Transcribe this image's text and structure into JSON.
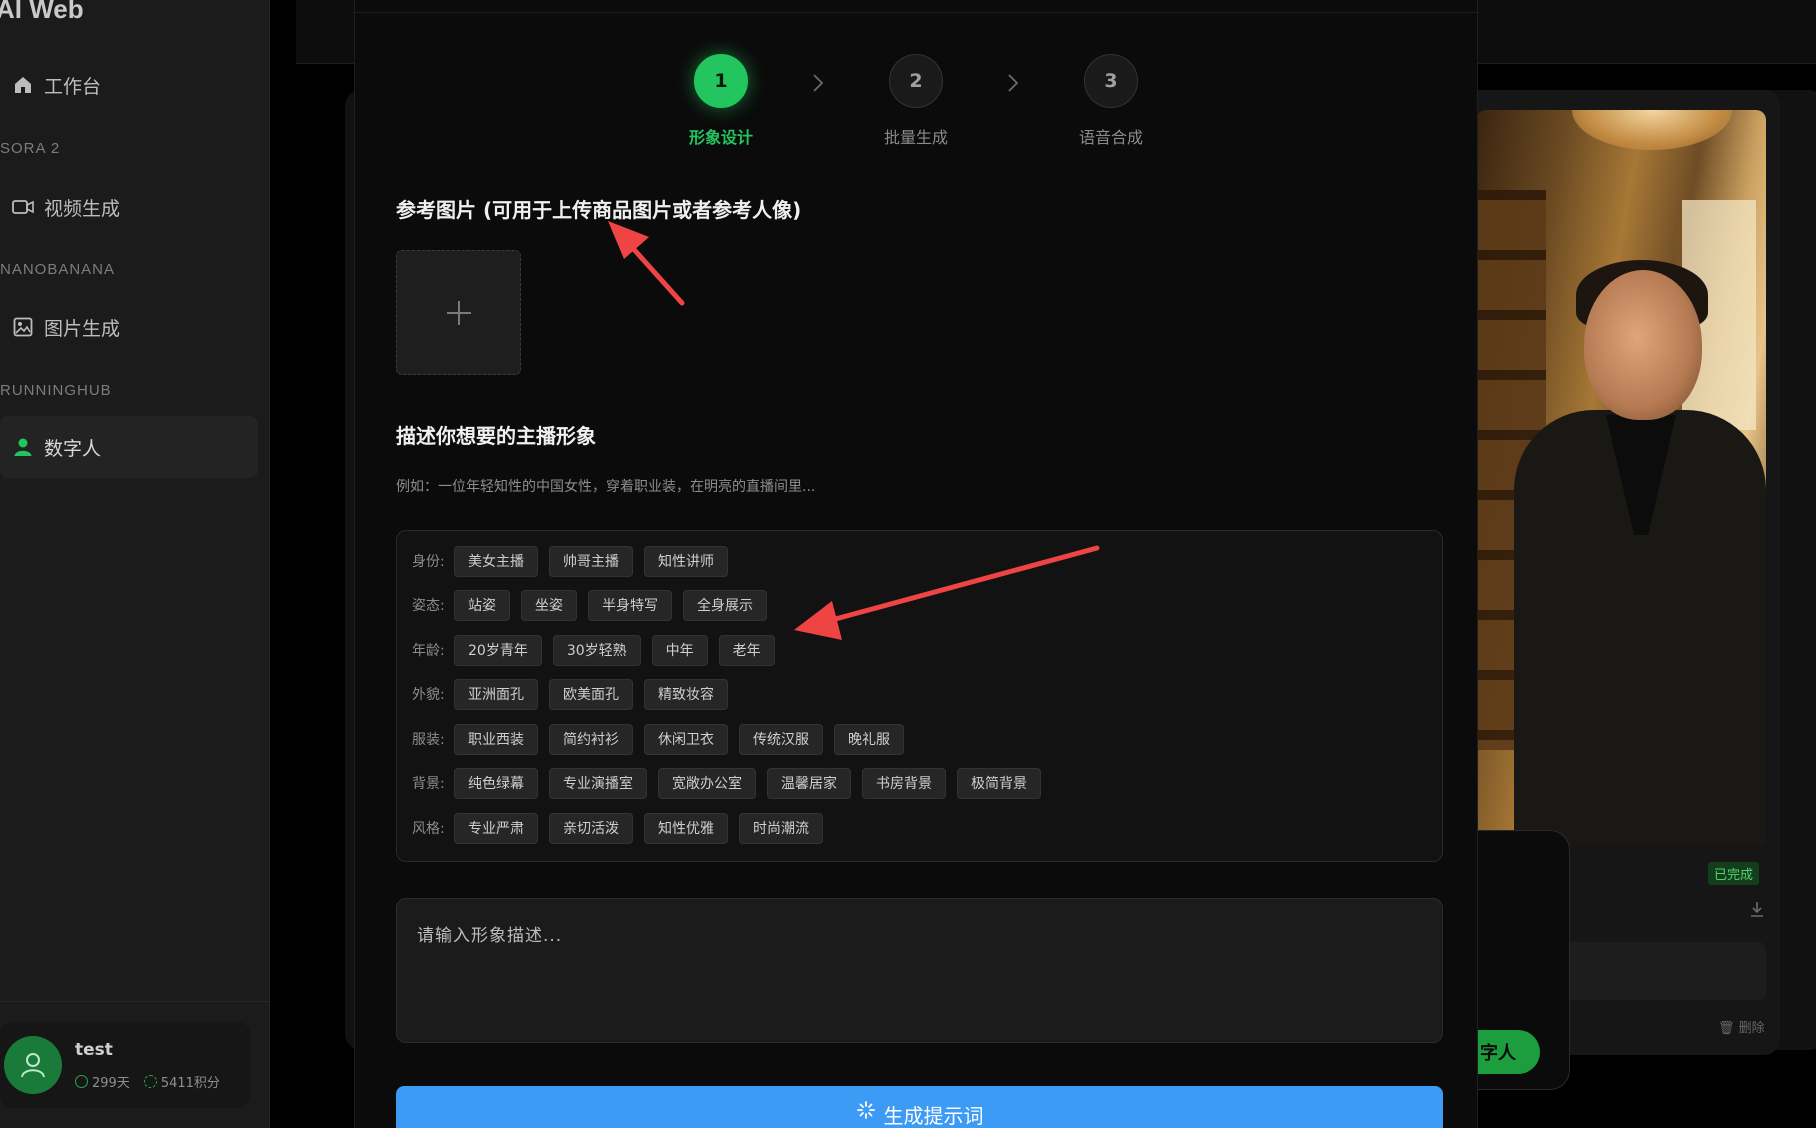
{
  "sidebar": {
    "brand": "AI Web",
    "nav": [
      {
        "label": "工作台",
        "icon": "home-icon"
      },
      {
        "label": "视频生成",
        "icon": "video-icon"
      },
      {
        "label": "图片生成",
        "icon": "image-icon"
      },
      {
        "label": "数字人",
        "icon": "user-icon"
      }
    ],
    "sections": [
      "SORA 2",
      "NANOBANANA",
      "RUNNINGHUB"
    ],
    "user": {
      "name": "test",
      "days": "299天",
      "points": "5411积分"
    }
  },
  "background": {
    "status": "已完成",
    "delete": "删除",
    "green_button": "字人"
  },
  "modal": {
    "steps": [
      {
        "num": "1",
        "label": "形象设计"
      },
      {
        "num": "2",
        "label": "批量生成"
      },
      {
        "num": "3",
        "label": "语音合成"
      }
    ],
    "ref_title": "参考图片 (可用于上传商品图片或者参考人像)",
    "upload_plus": "+",
    "describe_title": "描述你想要的主播形象",
    "hint": "例如：一位年轻知性的中国女性，穿着职业装，在明亮的直播间里...",
    "tag_groups": [
      {
        "label": "身份:",
        "tags": [
          "美女主播",
          "帅哥主播",
          "知性讲师"
        ]
      },
      {
        "label": "姿态:",
        "tags": [
          "站姿",
          "坐姿",
          "半身特写",
          "全身展示"
        ]
      },
      {
        "label": "年龄:",
        "tags": [
          "20岁青年",
          "30岁轻熟",
          "中年",
          "老年"
        ]
      },
      {
        "label": "外貌:",
        "tags": [
          "亚洲面孔",
          "欧美面孔",
          "精致妆容"
        ]
      },
      {
        "label": "服装:",
        "tags": [
          "职业西装",
          "简约衬衫",
          "休闲卫衣",
          "传统汉服",
          "晚礼服"
        ]
      },
      {
        "label": "背景:",
        "tags": [
          "纯色绿幕",
          "专业演播室",
          "宽敞办公室",
          "温馨居家",
          "书房背景",
          "极简背景"
        ]
      },
      {
        "label": "风格:",
        "tags": [
          "专业严肃",
          "亲切活泼",
          "知性优雅",
          "时尚潮流"
        ]
      }
    ],
    "desc_placeholder": "请输入形象描述...",
    "generate_button": "生成提示词"
  },
  "colors": {
    "accent_green": "#22c55e",
    "primary_blue": "#3b9bf5",
    "annotation_red": "#ef4444"
  }
}
